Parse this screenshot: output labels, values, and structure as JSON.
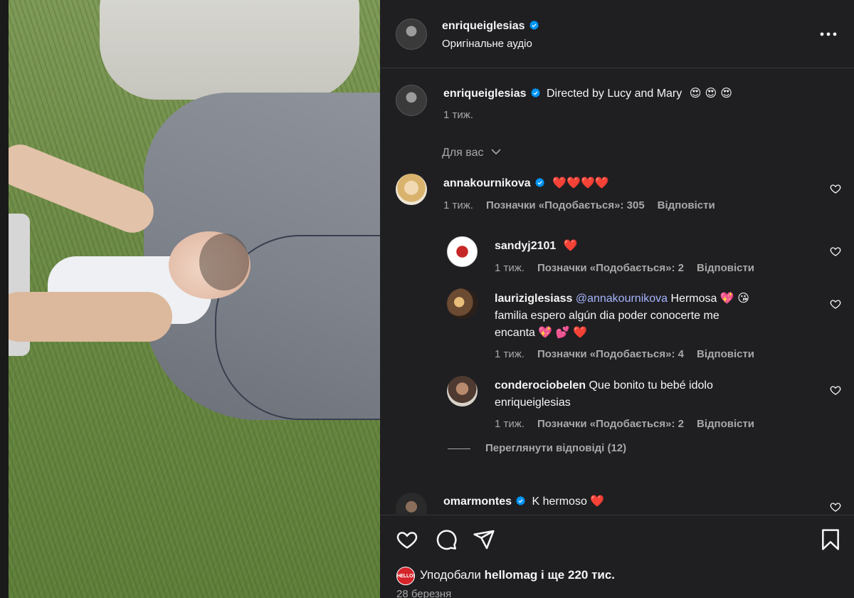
{
  "header": {
    "username": "enriqueiglesias",
    "audio": "Оригінальне аудіо",
    "more": "•••"
  },
  "caption": {
    "username": "enriqueiglesias",
    "text": "Directed by Lucy and Mary",
    "emojis": "😍 😍 😍",
    "time": "1 тиж."
  },
  "filter": {
    "label": "Для вас"
  },
  "comments": [
    {
      "username": "annakournikova",
      "verified": true,
      "text": "❤️❤️❤️❤️",
      "time": "1 тиж.",
      "likes": "Позначки «Подобається»: 305",
      "reply": "Відповісти"
    },
    {
      "username": "sandyj2101",
      "text": "❤️",
      "time": "1 тиж.",
      "likes": "Позначки «Подобається»: 2",
      "reply": "Відповісти"
    },
    {
      "username": "lauriziglesiass",
      "mention": "@annakournikova",
      "text_line1": "Hermosa 💖 😘",
      "text_line2": "familia espero algún dia poder conocerte me",
      "text_line3": "encanta 💖 💕 ❤️",
      "time": "1 тиж.",
      "likes": "Позначки «Подобається»: 4",
      "reply": "Відповісти"
    },
    {
      "username": "conderociobelen",
      "text_line1": "Que bonito tu bebé idolo",
      "text_line2": "enriqueiglesias",
      "time": "1 тиж.",
      "likes": "Позначки «Подобається»: 2",
      "reply": "Відповісти"
    },
    {
      "username": "omarmontes",
      "verified": true,
      "text": "K hermoso ❤️"
    }
  ],
  "view_replies": "Переглянути відповіді (12)",
  "footer": {
    "liked_prefix": "Уподобали",
    "liked_user": "hellomag",
    "liked_suffix": "і ще 220 тис.",
    "hellomag_badge": "HELLO!",
    "date": "28 березня"
  },
  "colors": {
    "panel_bg": "#1f1f22",
    "text": "#f5f5f5",
    "muted": "#a8a8a8",
    "verified": "#0095f6",
    "heart": "#ff3040",
    "mention": "#a5b4fc"
  },
  "icons": [
    "more-icon",
    "verified-badge-icon",
    "chevron-down-icon",
    "heart-outline-icon",
    "comment-icon",
    "share-icon",
    "bookmark-icon"
  ]
}
